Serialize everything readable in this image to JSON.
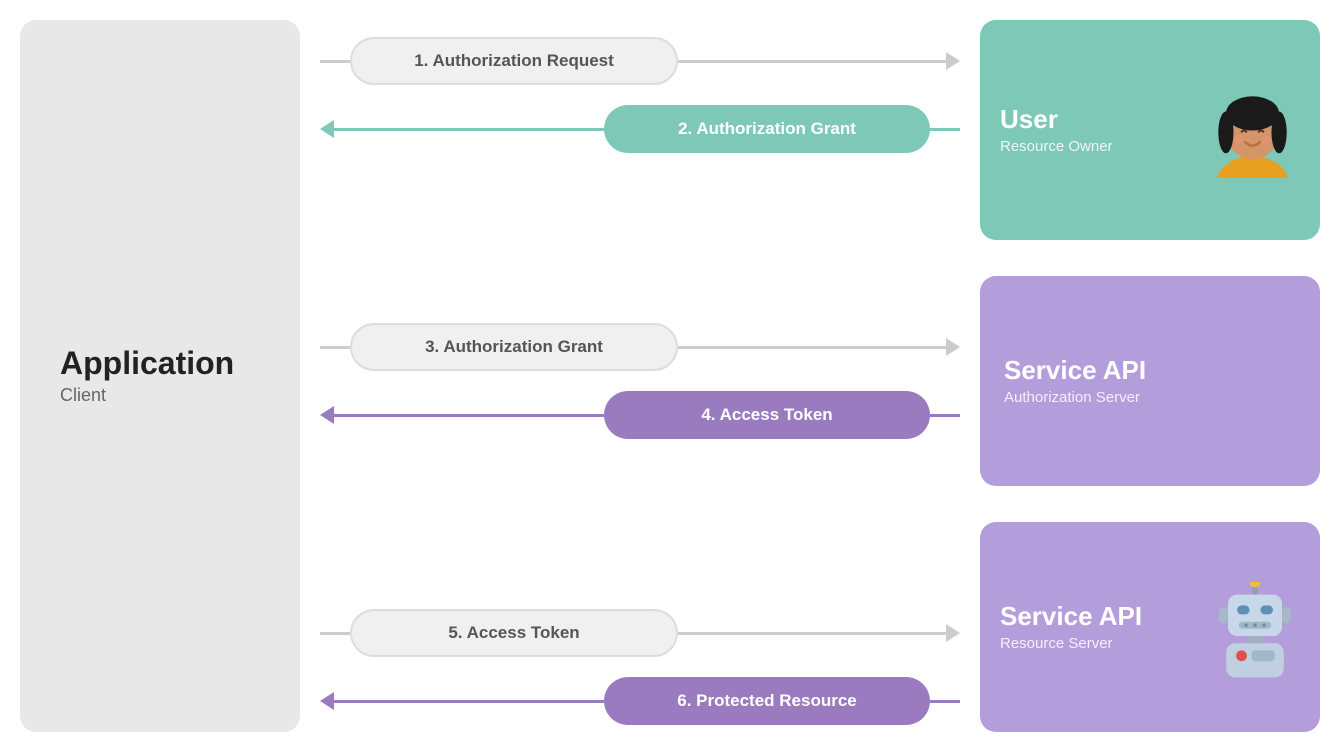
{
  "client": {
    "title": "Application",
    "subtitle": "Client"
  },
  "flows": {
    "group1": {
      "step1": {
        "label": "1. Authorization Request",
        "direction": "right",
        "style": "outline"
      },
      "step2": {
        "label": "2. Authorization Grant",
        "direction": "left",
        "style": "teal"
      }
    },
    "group2": {
      "step3": {
        "label": "3. Authorization Grant",
        "direction": "right",
        "style": "outline"
      },
      "step4": {
        "label": "4. Access Token",
        "direction": "left",
        "style": "purple"
      }
    },
    "group3": {
      "step5": {
        "label": "5. Access Token",
        "direction": "right",
        "style": "outline"
      },
      "step6": {
        "label": "6. Protected Resource",
        "direction": "left",
        "style": "purple"
      }
    }
  },
  "panels": {
    "user": {
      "title": "User",
      "subtitle": "Resource Owner"
    },
    "authServer": {
      "title": "Service API",
      "subtitle": "Authorization Server"
    },
    "resourceServer": {
      "title": "Service API",
      "subtitle": "Resource Server"
    }
  },
  "colors": {
    "teal": "#7ec8b8",
    "purple": "#9b7bbf",
    "outline": "#d0d0d0",
    "panelUserBg": "#7ec8b8",
    "panelAuthBg": "#b39ddb",
    "panelResBg": "#b39ddb",
    "clientBg": "#e4e4e4"
  }
}
